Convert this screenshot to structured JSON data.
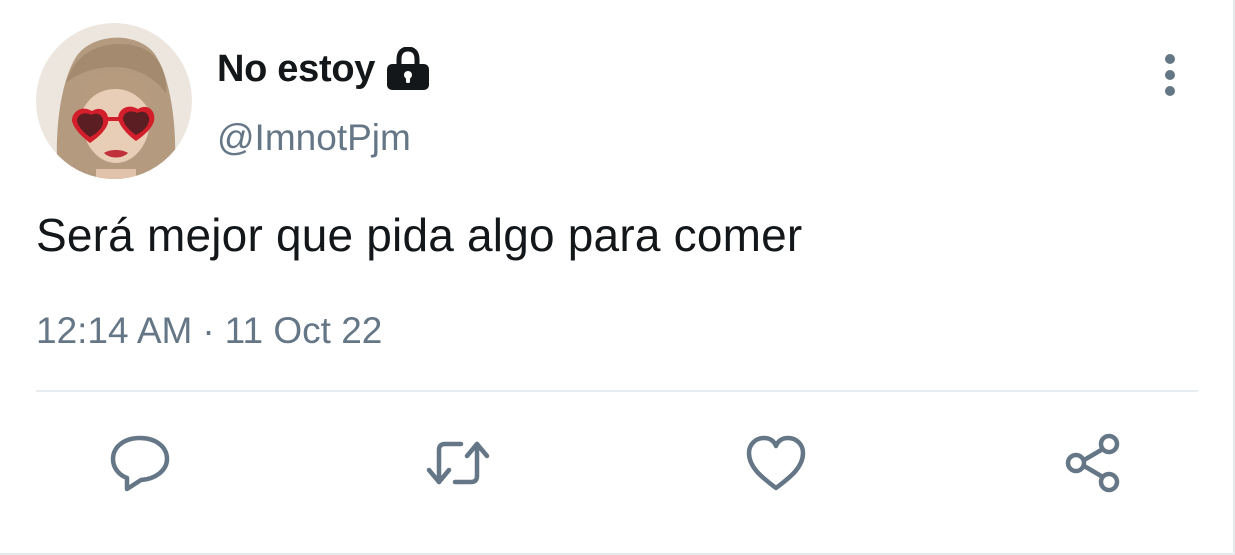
{
  "tweet": {
    "display_name": "No estoy",
    "handle": "@ImnotPjm",
    "text": "Será mejor que pida algo para comer",
    "time": "12:14 AM",
    "separator": "·",
    "date": "11 Oct 22",
    "protected": true
  },
  "icons": {
    "avatar": "profile-photo",
    "lock": "lock-icon",
    "more": "more-vertical-icon",
    "reply": "reply-icon",
    "retweet": "retweet-icon",
    "like": "heart-icon",
    "share": "share-icon"
  },
  "colors": {
    "text_primary": "#14171a",
    "text_secondary": "#657786",
    "icon": "#657786",
    "divider": "#e6ecf0"
  }
}
